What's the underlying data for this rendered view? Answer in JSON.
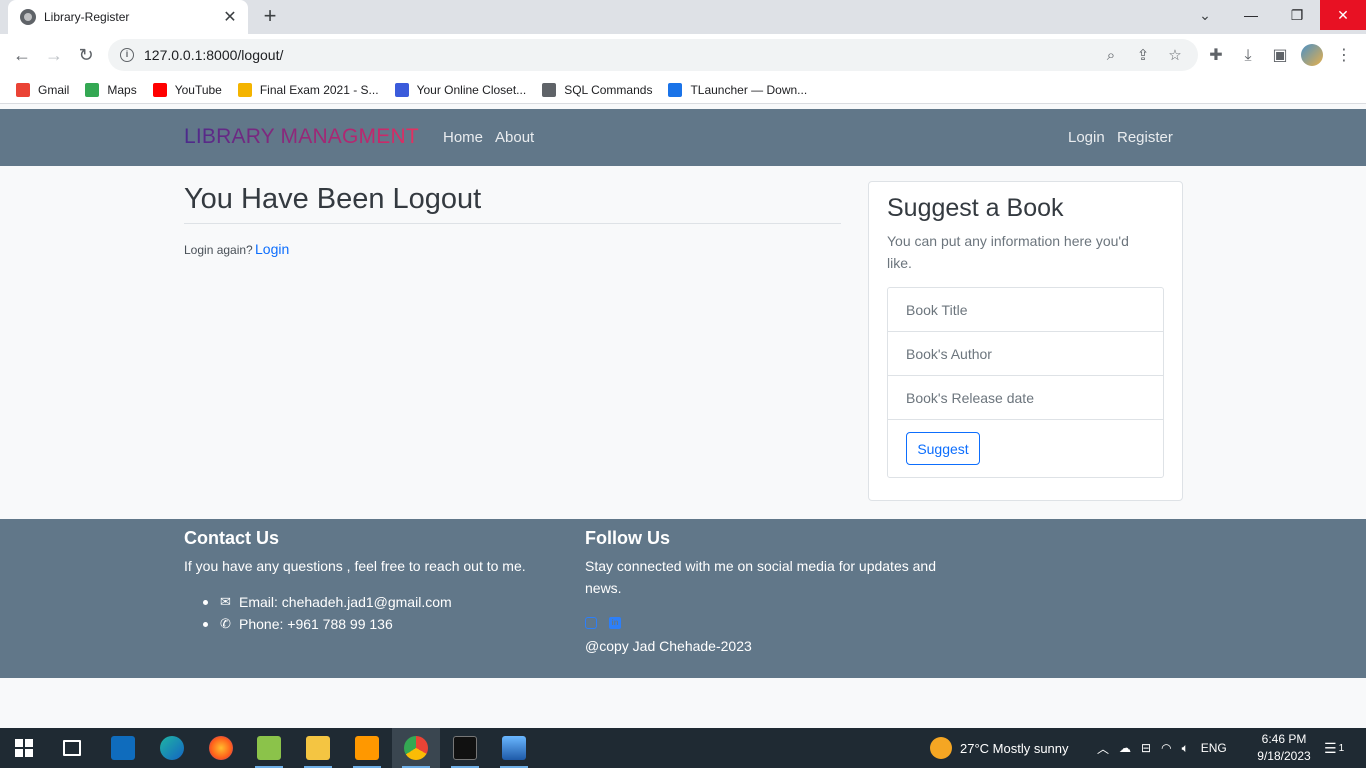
{
  "browser": {
    "tab_title": "Library-Register",
    "url": "127.0.0.1:8000/logout/",
    "bookmarks": [
      {
        "label": "Gmail",
        "icon": "gmail-icon",
        "color": "#ea4335"
      },
      {
        "label": "Maps",
        "icon": "maps-icon",
        "color": "#34a853"
      },
      {
        "label": "YouTube",
        "icon": "youtube-icon",
        "color": "#ff0000"
      },
      {
        "label": "Final Exam 2021 - S...",
        "icon": "classroom-icon",
        "color": "#f4b400"
      },
      {
        "label": "Your Online Closet...",
        "icon": "closet-icon",
        "color": "#3b5bdb"
      },
      {
        "label": "SQL Commands",
        "icon": "globe-icon",
        "color": "#5f6368"
      },
      {
        "label": "TLauncher — Down...",
        "icon": "tlauncher-icon",
        "color": "#1a73e8"
      }
    ]
  },
  "navbar": {
    "brand": "LIBRARY MANAGMENT",
    "links": {
      "home": "Home",
      "about": "About",
      "login": "Login",
      "register": "Register"
    },
    "bg_color": "#617789"
  },
  "main": {
    "title": "You Have Been Logout",
    "relogin_text": "Login again?",
    "relogin_link": "Login"
  },
  "suggest": {
    "title": "Suggest a Book",
    "description": "You can put any information here you'd like.",
    "fields": [
      "Book Title",
      "Book's Author",
      "Book's Release date"
    ],
    "button": "Suggest"
  },
  "footer": {
    "contact_title": "Contact Us",
    "contact_text": "If you have any questions , feel free to reach out to me.",
    "email": "Email: chehadeh.jad1@gmail.com",
    "phone": "Phone: +961 788 99 136",
    "follow_title": "Follow Us",
    "follow_text": "Stay connected with me on social media for updates and news.",
    "copyright": "@copy Jad Chehade-2023"
  },
  "taskbar": {
    "weather": "27°C  Mostly sunny",
    "language": "ENG",
    "time": "6:46 PM",
    "date": "9/18/2023",
    "notifications": "1"
  }
}
